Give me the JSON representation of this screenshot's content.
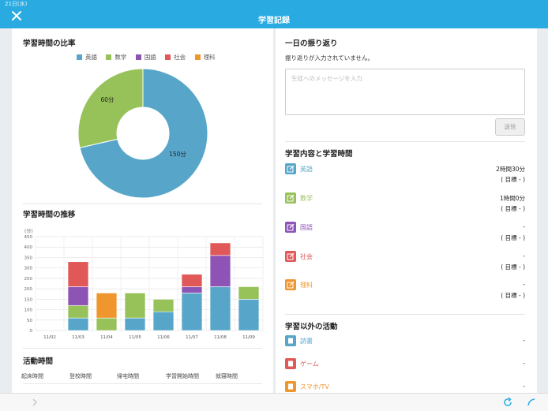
{
  "status": {
    "date": "21日(水)"
  },
  "header": {
    "title": "学習記録"
  },
  "left": {
    "ratio_title": "学習時間の比率",
    "trend_title": "学習時間の推移",
    "activity_title": "活動時間",
    "activity_columns": [
      "起床時間",
      "登校時間",
      "帰宅時間",
      "学習開始時間",
      "就寝時間"
    ]
  },
  "legend": [
    {
      "name": "英語",
      "color": "#57a6ca"
    },
    {
      "name": "数学",
      "color": "#97c159"
    },
    {
      "name": "国語",
      "color": "#8e54b5"
    },
    {
      "name": "社会",
      "color": "#e05858"
    },
    {
      "name": "理科",
      "color": "#f0962f"
    }
  ],
  "chart_data": [
    {
      "type": "pie",
      "labels": [
        "英語",
        "数学"
      ],
      "values": [
        150,
        60
      ],
      "data_labels": [
        "150分",
        "60分"
      ]
    },
    {
      "type": "bar",
      "stacked": true,
      "ylabel": "(分)",
      "ylim": [
        0,
        450
      ],
      "yticks": [
        0,
        50,
        100,
        150,
        200,
        250,
        300,
        350,
        400,
        450
      ],
      "categories": [
        "11/02",
        "11/03",
        "11/04",
        "11/05",
        "11/06",
        "11/07",
        "11/08",
        "11/09"
      ],
      "series": [
        {
          "name": "英語",
          "color": "#57a6ca",
          "values": [
            0,
            60,
            0,
            60,
            90,
            180,
            210,
            150
          ]
        },
        {
          "name": "数学",
          "color": "#97c159",
          "values": [
            0,
            60,
            60,
            120,
            60,
            0,
            0,
            60
          ]
        },
        {
          "name": "国語",
          "color": "#8e54b5",
          "values": [
            0,
            90,
            0,
            0,
            0,
            30,
            150,
            0
          ]
        },
        {
          "name": "社会",
          "color": "#e05858",
          "values": [
            0,
            120,
            0,
            0,
            0,
            60,
            60,
            0
          ]
        },
        {
          "name": "理科",
          "color": "#f0962f",
          "values": [
            0,
            0,
            120,
            0,
            0,
            0,
            0,
            0
          ]
        }
      ],
      "grid": true
    }
  ],
  "right": {
    "reflection_title": "一日の振り返り",
    "reflection_empty": "振り返りが入力されていません。",
    "message_placeholder": "生徒へのメッセージを入力",
    "send_label": "送信",
    "study_title": "学習内容と学習時間",
    "other_title": "学習以外の活動",
    "subjects": [
      {
        "name": "英語",
        "color": "#57a6ca",
        "time": "2時間30分",
        "goal": "( 目標 - )"
      },
      {
        "name": "数学",
        "color": "#97c159",
        "time": "1時間0分",
        "goal": "( 目標 - )"
      },
      {
        "name": "国語",
        "color": "#8e54b5",
        "time": "-",
        "goal": "( 目標 - )"
      },
      {
        "name": "社会",
        "color": "#e05858",
        "time": "-",
        "goal": "( 目標 - )"
      },
      {
        "name": "理科",
        "color": "#f0962f",
        "time": "-",
        "goal": "( 目標 - )"
      }
    ],
    "activities": [
      {
        "name": "読書",
        "color": "#57a6ca",
        "value": "-"
      },
      {
        "name": "ゲーム",
        "color": "#e05858",
        "value": "-"
      },
      {
        "name": "スマホ/TV",
        "color": "#f0962f",
        "value": "-"
      }
    ]
  }
}
